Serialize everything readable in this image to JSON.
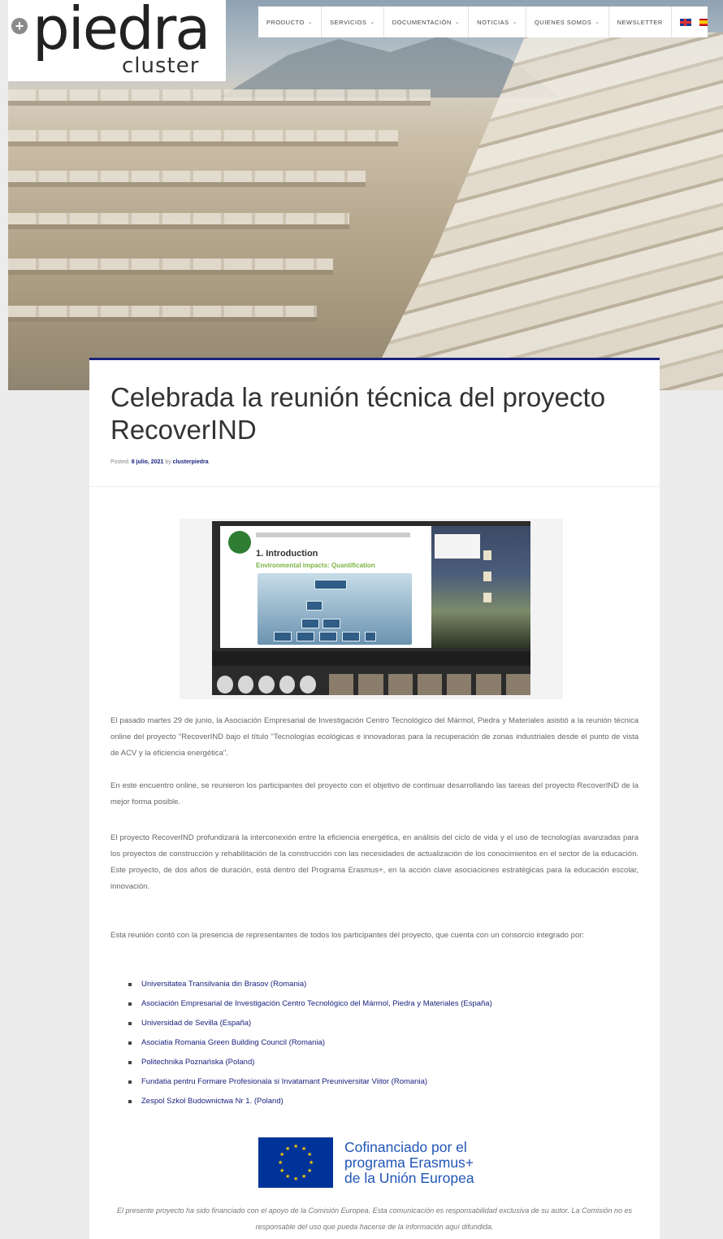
{
  "logo": {
    "word": "piedra",
    "sub": "cluster"
  },
  "nav": {
    "items": [
      {
        "label": "PRODUCTO",
        "has_caret": true
      },
      {
        "label": "SERVICIOS",
        "has_caret": true
      },
      {
        "label": "DOCUMENTACIÓN",
        "has_caret": true
      },
      {
        "label": "NOTICIAS",
        "has_caret": true
      },
      {
        "label": "QUIENES SOMOS",
        "has_caret": true
      },
      {
        "label": "NEWSLETTER",
        "has_caret": false
      }
    ],
    "caret": "⌄",
    "languages": [
      "en-flag-icon",
      "es-flag-icon"
    ]
  },
  "article": {
    "title": "Celebrada la reunión técnica del proyecto RecoverIND",
    "meta_prefix": "Posted: ",
    "date": "8 julio, 2021",
    "meta_by": " by ",
    "author": "clusterpiedra",
    "image": {
      "slide_heading": "1. Introduction",
      "slide_subheading": "Environmental impacts: Quantification"
    },
    "paragraphs": [
      "El pasado martes 29 de junio, la Asociación Empresarial de Investigación Centro Tecnológico del Mármol, Piedra y Materiales asistió a la reunión técnica online del proyecto \"RecoverIND bajo el título \"Tecnologías ecológicas e innovadoras para la recuperación de zonas industriales desde el punto de vista de ACV y la eficiencia energética\".",
      "En este encuentro online, se reunieron los participantes del proyecto con el objetivo de continuar desarrollando las tareas del proyecto RecoverIND de la mejor forma posible.",
      "El proyecto RecoverIND profundizará la interconexión entre la eficiencia energética, en análisis del ciclo de vida y el uso de tecnologías avanzadas para los proyectos de construcción y rehabilitación de la construcción con las necesidades de actualización de los conocimientos en el sector de la educación. Este proyecto, de dos años de duración, está dentro del Programa Erasmus+, en la acción clave asociaciones estratégicas para la educación escolar, innovación.",
      "Esta reunión contó con la presencia de representantes de todos los participantes del proyecto, que cuenta con un consorcio integrado por:"
    ],
    "partners": [
      "Universitatea Transilvania din Brasov (Romania)",
      "Asociación Empresarial de Investigación Centro Tecnológico del Mármol, Piedra y Materiales (España)",
      "Universidad de Sevilla (España)",
      "Asociatia Romania Green Building Council (Romania)",
      "Politechnika Poznańska (Poland)",
      "Fundatia pentru Formare Profesionala si Invatamant Preuniversitar Viitor (Romania)",
      "Zespol Szkol Budownictwa Nr 1. (Poland)"
    ],
    "eu_logo": {
      "line1": "Cofinanciado por el",
      "line2": "programa Erasmus+",
      "line3": "de la Unión Europea"
    },
    "disclaimer": "El presente proyecto ha sido financiado con el apoyo de la Comisión Europea. Esta comunicación es responsabilidad exclusiva de su autor. La Comisión no es responsable del uso que pueda hacerse de la información aquí difundida."
  },
  "colors": {
    "accent": "#1a237e",
    "eu_blue": "#003399",
    "eu_text": "#2256b8"
  }
}
